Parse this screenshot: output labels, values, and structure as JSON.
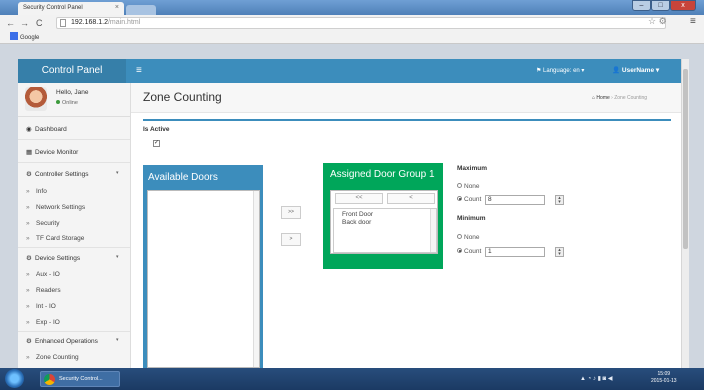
{
  "browser": {
    "tab_title": "Security Control Panel",
    "tab_close": "×",
    "url_host": "192.168.1.2",
    "url_path": "/main.html",
    "bookmark": "Google",
    "window_close": "x"
  },
  "header": {
    "brand": "Control Panel",
    "menu_glyph": "≡",
    "language": "Language: en",
    "username": "UserName"
  },
  "sidebar": {
    "user_name": "Hello, Jane",
    "user_status": "Online",
    "items": {
      "dashboard": "Dashboard",
      "device_monitor": "Device Monitor",
      "controller_settings": "Controller Settings",
      "info": "Info",
      "network_settings": "Network Settings",
      "security": "Security",
      "tf_card_storage": "TF Card Storage",
      "device_settings": "Device Settings",
      "aux_io": "Aux - IO",
      "readers": "Readers",
      "int_io": "Int - IO",
      "exp_io": "Exp - IO",
      "enhanced_operations": "Enhanced Operations",
      "zone_counting": "Zone Counting"
    }
  },
  "content": {
    "title": "Zone Counting",
    "breadcrumb_home": "Home",
    "breadcrumb_current": "Zone Counting",
    "is_active_label": "Is Active",
    "is_active_checked": true,
    "available_doors_title": "Available Doors",
    "assigned_group_title": "Assigned Door Group 1",
    "move_right_label": ">>",
    "move_one_label": ">",
    "order_all_label": "<<",
    "order_one_label": "<",
    "assigned_doors": [
      "Front Door",
      "Back door"
    ],
    "maximum": {
      "label": "Maximum",
      "none_label": "None",
      "count_label": "Count",
      "selected": "Count",
      "count_value": "8"
    },
    "minimum": {
      "label": "Minimum",
      "none_label": "None",
      "count_label": "Count",
      "selected": "Count",
      "count_value": "1"
    }
  },
  "taskbar": {
    "task_label": "Security Control...",
    "time": "15:09",
    "date": "2015-01-13"
  },
  "colors": {
    "header_blue": "#3c8dbc",
    "group_green": "#00a65a"
  }
}
